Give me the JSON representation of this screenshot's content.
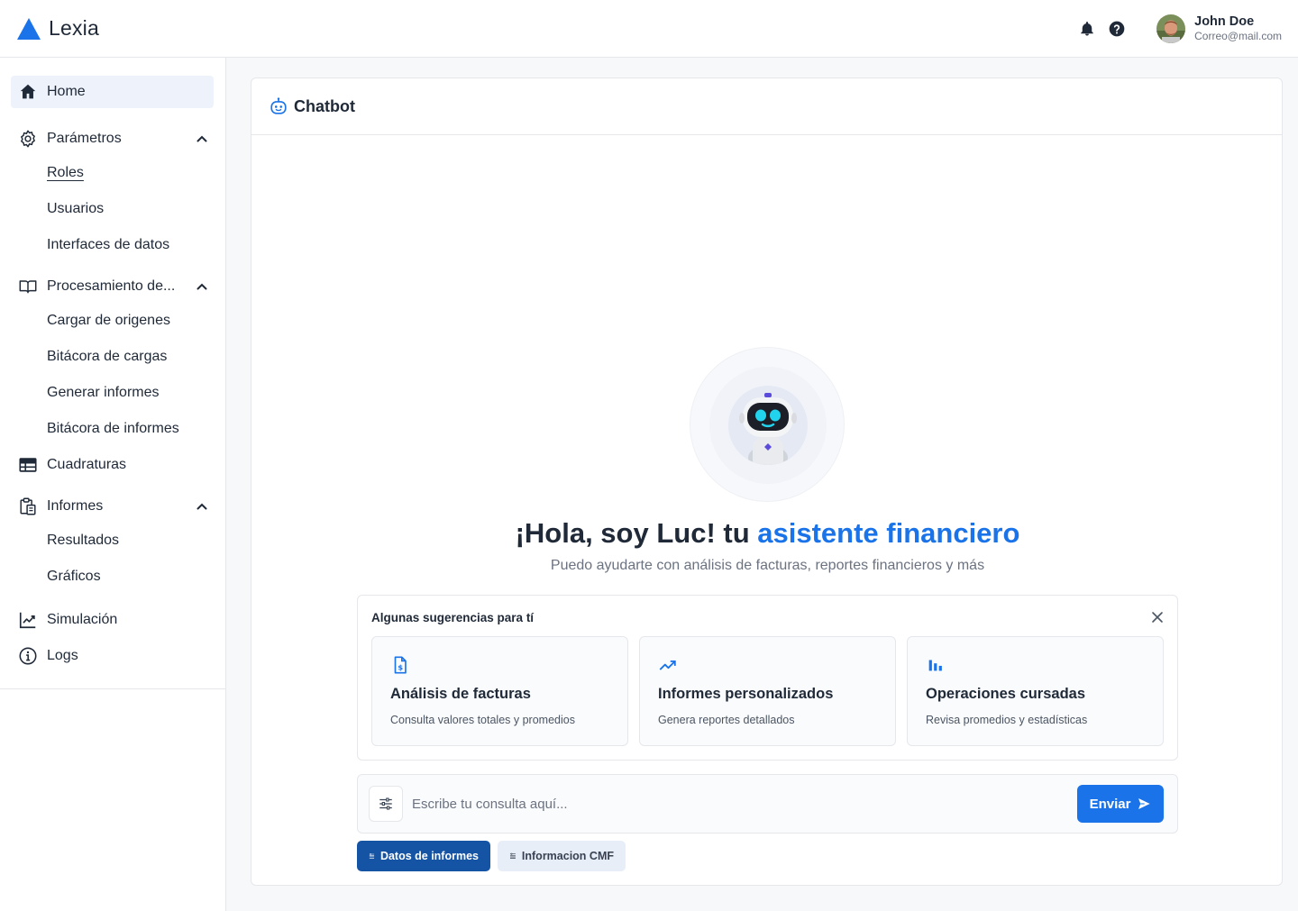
{
  "header": {
    "brand_name": "Lexia",
    "brand_color": "#1a73e8",
    "icons": [
      "bell-icon",
      "help-icon"
    ],
    "user": {
      "name": "John Doe",
      "email": "Correo@mail.com"
    }
  },
  "sidebar": {
    "items": [
      {
        "label": "Home",
        "icon": "home-icon",
        "active": true
      },
      {
        "label": "Parámetros",
        "icon": "gear-icon",
        "expanded": true,
        "children": [
          "Roles",
          "Usuarios",
          "Interfaces de datos"
        ]
      },
      {
        "label": "Procesamiento de...",
        "icon": "book-icon",
        "expanded": true,
        "children": [
          "Cargar de origenes",
          "Bitácora de cargas",
          "Generar informes",
          "Bitácora de informes"
        ]
      },
      {
        "label": "Cuadraturas",
        "icon": "table-icon"
      },
      {
        "label": "Informes",
        "icon": "clipboard-icon",
        "expanded": true,
        "children": [
          "Resultados",
          "Gráficos"
        ]
      },
      {
        "label": "Simulación",
        "icon": "chart-line-icon"
      },
      {
        "label": "Logs",
        "icon": "info-icon"
      }
    ]
  },
  "chatbot": {
    "title": "Chatbot",
    "greeting_prefix": "¡Hola, soy Luc! tu ",
    "greeting_highlight": "asistente financiero",
    "subtitle": "Puedo ayudarte con análisis de facturas, reportes financieros y más",
    "suggestions": {
      "title": "Algunas sugerencias para tí",
      "cards": [
        {
          "icon": "invoice-icon",
          "title": "Análisis de facturas",
          "description": "Consulta valores totales y promedios"
        },
        {
          "icon": "trending-up-icon",
          "title": "Informes personalizados",
          "description": "Genera reportes detallados"
        },
        {
          "icon": "bar-chart-icon",
          "title": "Operaciones cursadas",
          "description": "Revisa promedios y estadísticas"
        }
      ]
    },
    "input": {
      "placeholder": "Escribe tu consulta aquí...",
      "value": ""
    },
    "send_label": "Enviar",
    "chips": [
      "Datos de informes",
      "Informacion CMF"
    ]
  }
}
